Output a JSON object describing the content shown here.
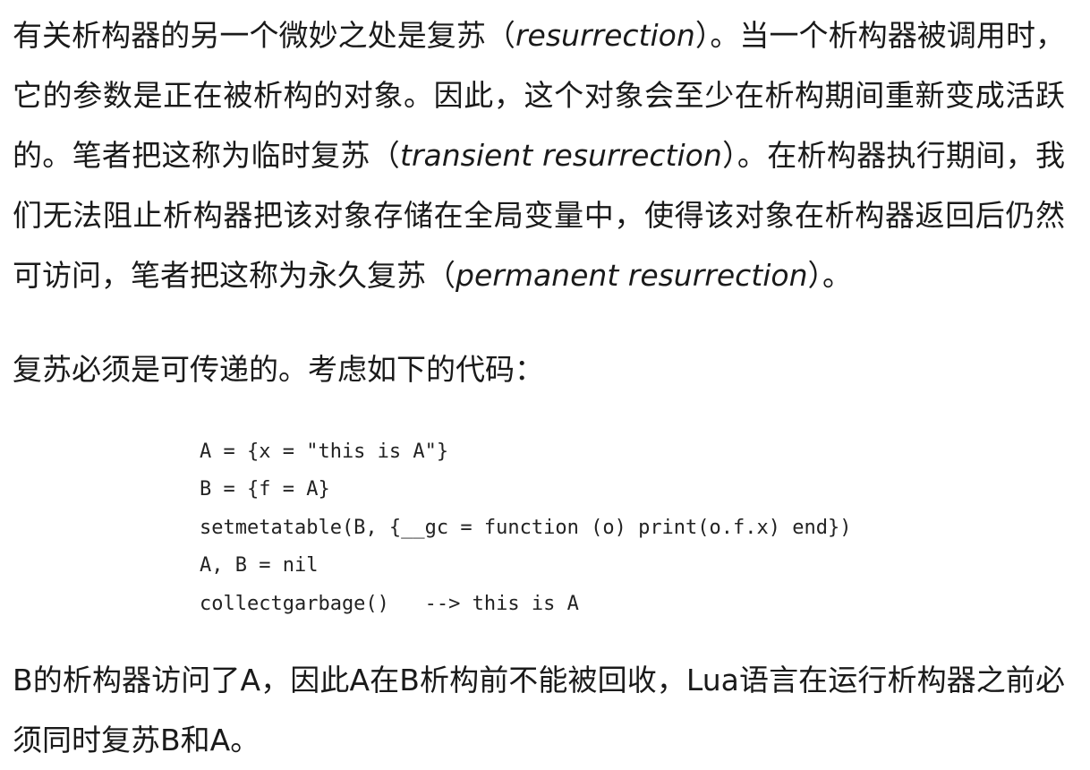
{
  "paragraph_1": {
    "t1": "有关析构器的另一个微妙之处是复苏（",
    "e1": "resurrection",
    "t2": "）。当一个析构器被调用时，它的参数是正在被析构的对象。因此，这个对象会至少在析构期间重新变成活跃的。笔者把这称为临时复苏（",
    "e2": "transient resurrection",
    "t3": "）。在析构器执行期间，我们无法阻止析构器把该对象存储在全局变量中，使得该对象在析构器返回后仍然可访问，笔者把这称为永久复苏（",
    "e3": "permanent resurrection",
    "t4": "）。"
  },
  "paragraph_2": {
    "text": "复苏必须是可传递的。考虑如下的代码："
  },
  "code": {
    "lines": [
      "A = {x = \"this is A\"}",
      "B = {f = A}",
      "setmetatable(B, {__gc = function (o) print(o.f.x) end})",
      "A, B = nil",
      "collectgarbage()   --> this is A"
    ]
  },
  "paragraph_3": {
    "text": "B的析构器访问了A，因此A在B析构前不能被回收，Lua语言在运行析构器之前必须同时复苏B和A。"
  }
}
